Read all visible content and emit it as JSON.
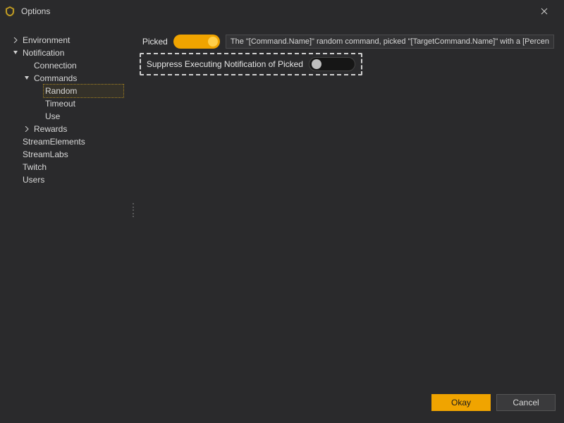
{
  "window": {
    "title": "Options"
  },
  "tree": {
    "environment": "Environment",
    "notification": "Notification",
    "connection": "Connection",
    "commands": "Commands",
    "random": "Random",
    "timeout": "Timeout",
    "use": "Use",
    "rewards": "Rewards",
    "streamelements": "StreamElements",
    "streamlabs": "StreamLabs",
    "twitch": "Twitch",
    "users": "Users"
  },
  "settings": {
    "picked_label": "Picked",
    "picked_value": "The \"[Command.Name]\" random command, picked \"[TargetCommand.Name]\" with a [Percen",
    "suppress_label": "Suppress Executing Notification of Picked"
  },
  "footer": {
    "ok": "Okay",
    "cancel": "Cancel"
  }
}
